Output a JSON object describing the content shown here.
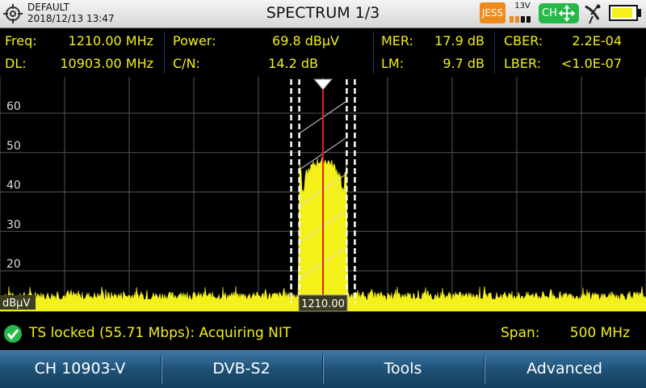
{
  "header": {
    "profile": "DEFAULT",
    "datetime": "2018/12/13 13:47",
    "title": "SPECTRUM 1/3",
    "jess_label": "JESS",
    "lnb_voltage": "13V",
    "ch_badge": "CH",
    "battery_level": 0.9
  },
  "measures": {
    "freq_label": "Freq:",
    "freq_value": "1210.00 MHz",
    "dl_label": "DL:",
    "dl_value": "10903.00 MHz",
    "power_label": "Power:",
    "power_value": "69.8 dBµV",
    "cn_label": "C/N:",
    "cn_value": "14.2 dB",
    "mer_label": "MER:",
    "mer_value": "17.9 dB",
    "lm_label": "LM:",
    "lm_value": "9.7 dB",
    "cber_label": "CBER:",
    "cber_value": "2.2E-04",
    "lber_label": "LBER:",
    "lber_value": "<1.0E-07"
  },
  "plot": {
    "unit_label": "dBµV",
    "y_ticks": [
      "60",
      "50",
      "40",
      "30",
      "20"
    ],
    "marker_label": "1210.00"
  },
  "status": {
    "lock_text": "TS locked (55.71 Mbps): Acquiring NIT",
    "span_label": "Span:",
    "span_value": "500 MHz"
  },
  "softkeys": [
    "CH 10903-V",
    "DVB-S2",
    "Tools",
    "Advanced"
  ],
  "chart_data": {
    "type": "area",
    "y_ticks": [
      60,
      50,
      40,
      30,
      20
    ],
    "ylim": [
      10,
      70
    ],
    "span_mhz": 500,
    "center_mhz": 1210.0,
    "marker_mhz": 1210.0,
    "channel_lower_mhz": 1191.0,
    "channel_upper_mhz": 1229.0,
    "noise_floor_dbuv": 12.5,
    "channel_level_dbuv": 48,
    "fill_color": "#f4f01a",
    "marker_color": "#e0201a"
  }
}
